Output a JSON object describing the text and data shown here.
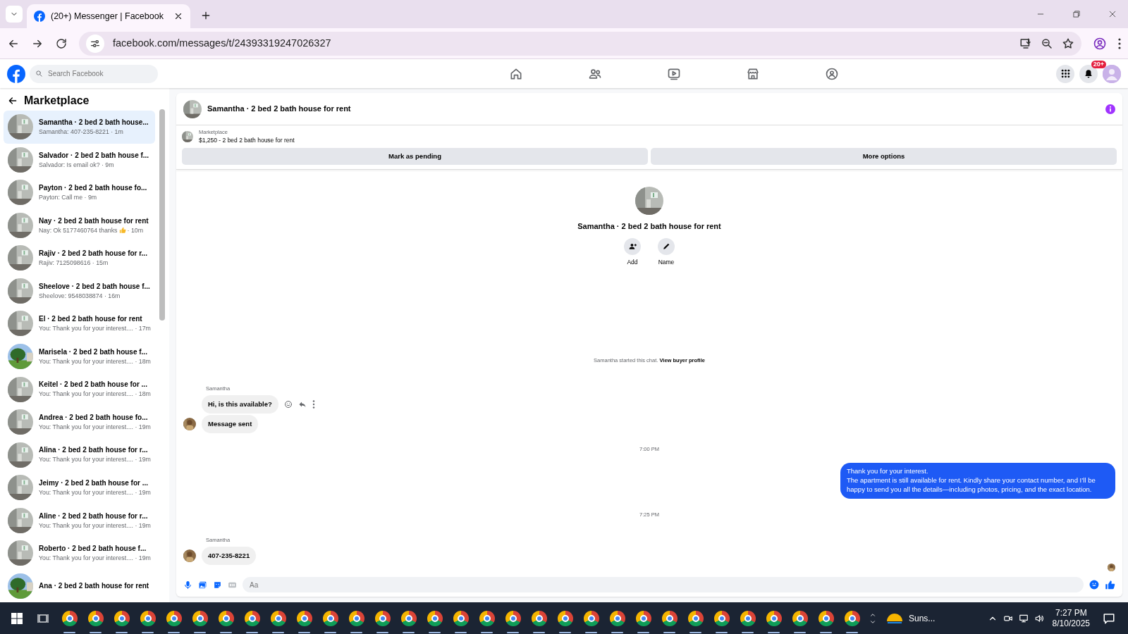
{
  "browser": {
    "tab_title": "(20+) Messenger | Facebook",
    "url": "facebook.com/messages/t/24393319247026327"
  },
  "facebook_header": {
    "search_placeholder": "Search Facebook",
    "notification_badge": "20+"
  },
  "sidebar": {
    "title": "Marketplace",
    "conversations": [
      {
        "title": "Samantha · 2 bed 2 bath house...",
        "preview": "Samantha: 407-235-8221",
        "time": "· 1m",
        "selected": true
      },
      {
        "title": "Salvador · 2 bed 2 bath house f...",
        "preview": "Salvador: Is email ok?",
        "time": "· 9m",
        "selected": false
      },
      {
        "title": "Payton · 2 bed 2 bath house fo...",
        "preview": "Payton: Call me",
        "time": "· 9m",
        "selected": false
      },
      {
        "title": "Nay · 2 bed 2 bath house for rent",
        "preview": "Nay: Ok 5177460764 thanks",
        "reaction_icon": true,
        "time": "· 10m",
        "selected": false
      },
      {
        "title": "Rajiv · 2 bed 2 bath house for r...",
        "preview": "Rajiv: 7125098616",
        "time": "· 15m",
        "selected": false
      },
      {
        "title": "Sheelove · 2 bed 2 bath house f...",
        "preview": "Sheelove: 9548038874",
        "time": "· 16m",
        "selected": false
      },
      {
        "title": "El · 2 bed 2 bath house for rent",
        "preview": "You: Thank you for your interest....",
        "time": "· 17m",
        "selected": false
      },
      {
        "title": "Marisela · 2 bed 2 bath house f...",
        "preview": "You: Thank you for your interest....",
        "time": "· 18m",
        "selected": false
      },
      {
        "title": "Keitel · 2 bed 2 bath house for ...",
        "preview": "You: Thank you for your interest....",
        "time": "· 18m",
        "selected": false
      },
      {
        "title": "Andrea · 2 bed 2 bath house fo...",
        "preview": "You: Thank you for your interest....",
        "time": "· 19m",
        "selected": false
      },
      {
        "title": "Alina · 2 bed 2 bath house for r...",
        "preview": "You: Thank you for your interest....",
        "time": "· 19m",
        "selected": false
      },
      {
        "title": "Jeimy · 2 bed 2 bath house for ...",
        "preview": "You: Thank you for your interest....",
        "time": "· 19m",
        "selected": false
      },
      {
        "title": "Aline · 2 bed 2 bath house for r...",
        "preview": "You: Thank you for your interest....",
        "time": "· 19m",
        "selected": false
      },
      {
        "title": "Roberto · 2 bed 2 bath house f...",
        "preview": "You: Thank you for your interest....",
        "time": "· 19m",
        "selected": false
      },
      {
        "title": "Ana · 2 bed 2 bath house for rent",
        "selected": false
      }
    ]
  },
  "chat": {
    "title": "Samantha · 2 bed 2 bath house for rent",
    "listing": {
      "label": "Marketplace",
      "item": "$1,250 - 2 bed 2 bath house for rent"
    },
    "buttons": [
      "Mark as pending",
      "More options"
    ],
    "profile": {
      "name": "Samantha · 2 bed 2 bath house for rent",
      "actions": [
        {
          "kind": "add",
          "label": "Add"
        },
        {
          "kind": "name",
          "label": "Name"
        }
      ]
    },
    "messages": [
      {
        "kind": "notice",
        "text": "Samantha started this chat.",
        "link": "View buyer profile"
      },
      {
        "kind": "sender",
        "text": "Samantha"
      },
      {
        "kind": "incoming",
        "text": "Hi, is this available?",
        "avatar": false,
        "hover_actions": true
      },
      {
        "kind": "incoming",
        "text": "Message sent",
        "avatar": true,
        "hover_actions": false
      },
      {
        "kind": "time",
        "text": "7:00 PM"
      },
      {
        "kind": "outgoing",
        "text": "Thank you for your interest.\nThe apartment is still available for rent. Kindly share your contact number, and I’ll be happy to send you all the details—including photos, pricing, and the exact location."
      },
      {
        "kind": "time",
        "text": "7:25 PM"
      },
      {
        "kind": "sender",
        "text": "Samantha"
      },
      {
        "kind": "incoming",
        "text": "407-235-8221",
        "avatar": true,
        "hover_actions": false
      }
    ],
    "read_receipt": true,
    "composer": {
      "placeholder": "Aa"
    }
  },
  "taskbar": {
    "apps": [
      {
        "kind": "chrome"
      },
      {
        "kind": "chrome"
      },
      {
        "kind": "chrome"
      },
      {
        "kind": "chrome"
      },
      {
        "kind": "chrome"
      },
      {
        "kind": "chrome"
      },
      {
        "kind": "chrome"
      },
      {
        "kind": "chrome"
      },
      {
        "kind": "chrome"
      },
      {
        "kind": "chrome"
      },
      {
        "kind": "chrome"
      },
      {
        "kind": "chrome"
      },
      {
        "kind": "chrome"
      },
      {
        "kind": "chrome"
      },
      {
        "kind": "chrome"
      },
      {
        "kind": "chrome"
      },
      {
        "kind": "chrome"
      },
      {
        "kind": "chrome"
      },
      {
        "kind": "chrome"
      },
      {
        "kind": "chrome"
      },
      {
        "kind": "chrome"
      },
      {
        "kind": "chrome"
      },
      {
        "kind": "chrome"
      },
      {
        "kind": "chrome"
      },
      {
        "kind": "chrome"
      },
      {
        "kind": "chrome"
      },
      {
        "kind": "chrome"
      },
      {
        "kind": "chrome"
      },
      {
        "kind": "chrome"
      },
      {
        "kind": "chrome"
      },
      {
        "kind": "chrome"
      }
    ],
    "weather": "Suns...",
    "time": "7:27 PM",
    "date": "8/10/2025"
  }
}
